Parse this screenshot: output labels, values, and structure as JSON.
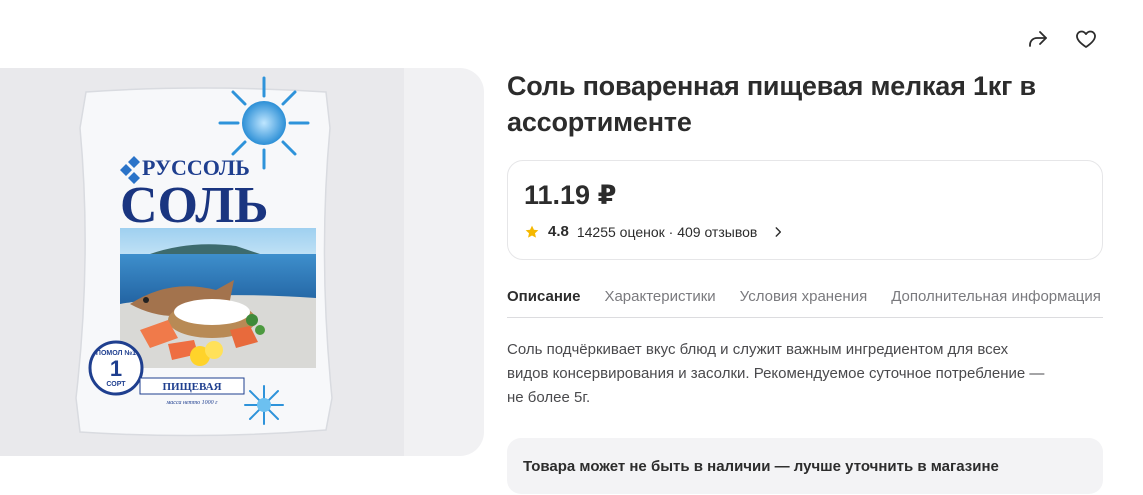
{
  "product": {
    "title_line1": "Соль поваренная пищевая мелкая 1кг в",
    "title_line2": "ассортименте",
    "price": "11.19 ₽",
    "rating_value": "4.8",
    "rating_text": "14255 оценок · 409 отзывов",
    "description_lines": [
      "Соль подчёркивает вкус блюд и служит важным ингредиентом для всех",
      "видов консервирования и засолки. Рекомендуемое суточное потребление —",
      "не более 5г."
    ],
    "availability_notice": "Товара может не быть в наличии — лучше уточнить в магазине"
  },
  "tabs": [
    {
      "label": "Описание",
      "active": true
    },
    {
      "label": "Характеристики",
      "active": false
    },
    {
      "label": "Условия хранения",
      "active": false
    },
    {
      "label": "Дополнительная информация",
      "active": false
    }
  ],
  "icons": {
    "share": "share-icon",
    "favorite": "heart-icon",
    "star": "star-icon",
    "chevron": "chevron-right-icon"
  },
  "package": {
    "brand": "РУССОЛЬ",
    "name": "СОЛЬ",
    "grade_line1": "ПОМОЛ №1",
    "grade_number": "1",
    "grade_line2": "СОРТ",
    "type": "ПИЩЕВАЯ",
    "net_weight": "масса нетто 1000 г"
  },
  "colors": {
    "star": "#f5b800",
    "text": "#2c2c2c",
    "muted": "#7a7a7e",
    "brand_blue": "#1f3f8f"
  }
}
